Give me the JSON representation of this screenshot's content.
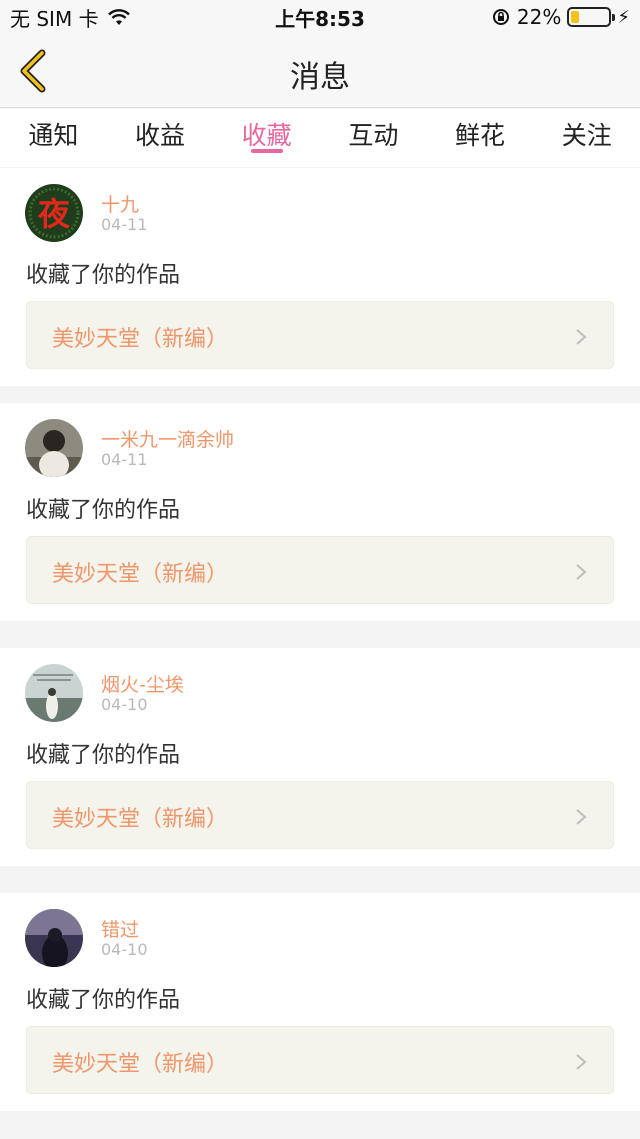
{
  "status": {
    "carrier": "无 SIM 卡",
    "time": "上午8:53",
    "battery": "22%",
    "battery_level": 0.22
  },
  "nav": {
    "title": "消息"
  },
  "tabs": [
    {
      "label": "通知"
    },
    {
      "label": "收益"
    },
    {
      "label": "收藏",
      "active": true
    },
    {
      "label": "互动"
    },
    {
      "label": "鲜花"
    },
    {
      "label": "关注"
    }
  ],
  "messages": [
    {
      "name": "十九",
      "date": "04-11",
      "action": "收藏了你的作品",
      "work": "美妙天堂（新编）"
    },
    {
      "name": "一米九一滴余帅",
      "date": "04-11",
      "action": "收藏了你的作品",
      "work": "美妙天堂（新编）"
    },
    {
      "name": "烟火-尘埃",
      "date": "04-10",
      "action": "收藏了你的作品",
      "work": "美妙天堂（新编）"
    },
    {
      "name": "错过",
      "date": "04-10",
      "action": "收藏了你的作品",
      "work": "美妙天堂（新编）"
    }
  ],
  "avatar_glyph": "夜",
  "colors": {
    "accent": "#e8689e",
    "name": "#f0966a",
    "work_bg": "#f4f4ec"
  }
}
